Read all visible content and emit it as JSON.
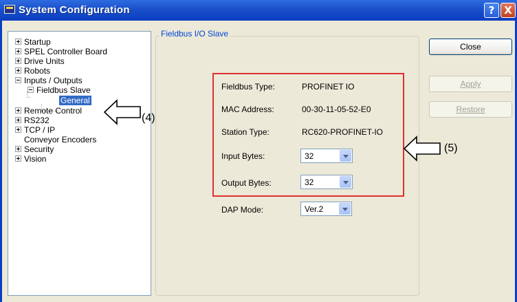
{
  "window": {
    "title": "System Configuration",
    "help_label": "?",
    "close_glyph": "X",
    "title_color": "#1a4fc9"
  },
  "tree": {
    "items": [
      {
        "label": "Startup",
        "expander": "plus"
      },
      {
        "label": "SPEL Controller Board",
        "expander": "plus"
      },
      {
        "label": "Drive Units",
        "expander": "plus"
      },
      {
        "label": "Robots",
        "expander": "plus"
      },
      {
        "label": "Inputs / Outputs",
        "expander": "minus"
      },
      {
        "label": "Fieldbus Slave",
        "expander": "minus"
      },
      {
        "label": "General",
        "selected": true
      },
      {
        "label": "Remote Control",
        "expander": "plus"
      },
      {
        "label": "RS232",
        "expander": "plus"
      },
      {
        "label": "TCP / IP",
        "expander": "plus"
      },
      {
        "label": "Conveyor Encoders"
      },
      {
        "label": "Security",
        "expander": "plus"
      },
      {
        "label": "Vision",
        "expander": "plus"
      }
    ]
  },
  "panel": {
    "group_title": "Fieldbus I/O Slave",
    "fieldbus_type_label": "Fieldbus Type:",
    "fieldbus_type_value": "PROFINET IO",
    "mac_label": "MAC Address:",
    "mac_value": "00-30-11-05-52-E0",
    "station_type_label": "Station Type:",
    "station_type_value": "RC620-PROFINET-IO",
    "input_bytes_label": "Input Bytes:",
    "input_bytes_value": "32",
    "output_bytes_label": "Output Bytes:",
    "output_bytes_value": "32",
    "dap_mode_label": "DAP Mode:",
    "dap_mode_value": "Ver.2"
  },
  "buttons": {
    "close": "Close",
    "apply": "Apply",
    "restore": "Restore"
  },
  "annotations": {
    "tree_callout": "(4)",
    "panel_callout": "(5)",
    "highlight_color": "#e03030"
  }
}
